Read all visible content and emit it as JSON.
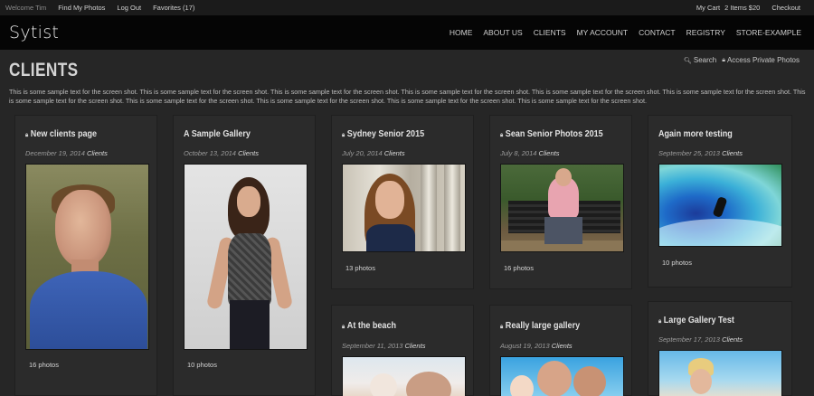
{
  "topbar": {
    "welcome": "Welcome Tim",
    "find_photos": "Find My Photos",
    "logout": "Log Out",
    "favorites": "Favorites (17)",
    "cart": "My Cart",
    "cart_items": "2 Items $20",
    "checkout": "Checkout"
  },
  "header": {
    "logo": "Sytist",
    "nav": [
      "HOME",
      "ABOUT US",
      "CLIENTS",
      "MY ACCOUNT",
      "CONTACT",
      "REGISTRY",
      "STORE-EXAMPLE"
    ]
  },
  "page": {
    "title": "CLIENTS",
    "search": "Search",
    "private": "Access Private Photos",
    "intro": "This is some sample text for the screen shot. This is some sample text for the screen shot. This is some sample text for the screen shot. This is some sample text for the screen shot. This is some sample text for the screen shot. This is some sample text for the screen shot. This is some sample text for the screen shot. This is some sample text for the screen shot. This is some sample text for the screen shot. This is some sample text for the screen shot. This is some sample text for the screen shot."
  },
  "galleries": [
    {
      "title": "New clients page",
      "locked": true,
      "date": "December 19, 2014",
      "category": "Clients",
      "count": "16 photos"
    },
    {
      "title": "A Sample Gallery",
      "locked": false,
      "date": "October 13, 2014",
      "category": "Clients",
      "count": "10 photos"
    },
    {
      "title": "Sydney Senior 2015",
      "locked": true,
      "date": "July 20, 2014",
      "category": "Clients",
      "count": "13 photos"
    },
    {
      "title": "Sean Senior Photos 2015",
      "locked": true,
      "date": "July 8, 2014",
      "category": "Clients",
      "count": "16 photos"
    },
    {
      "title": "Again more testing",
      "locked": false,
      "date": "September 25, 2013",
      "category": "Clients",
      "count": "10 photos"
    },
    {
      "title": "At the beach",
      "locked": true,
      "date": "September 11, 2013",
      "category": "Clients",
      "count": ""
    },
    {
      "title": "Really large gallery",
      "locked": true,
      "date": "August 19, 2013",
      "category": "Clients",
      "count": ""
    },
    {
      "title": "Large Gallery Test",
      "locked": true,
      "date": "September 17, 2013",
      "category": "Clients",
      "count": ""
    }
  ],
  "icons": {
    "lock": "lock-icon",
    "search": "search-icon"
  }
}
